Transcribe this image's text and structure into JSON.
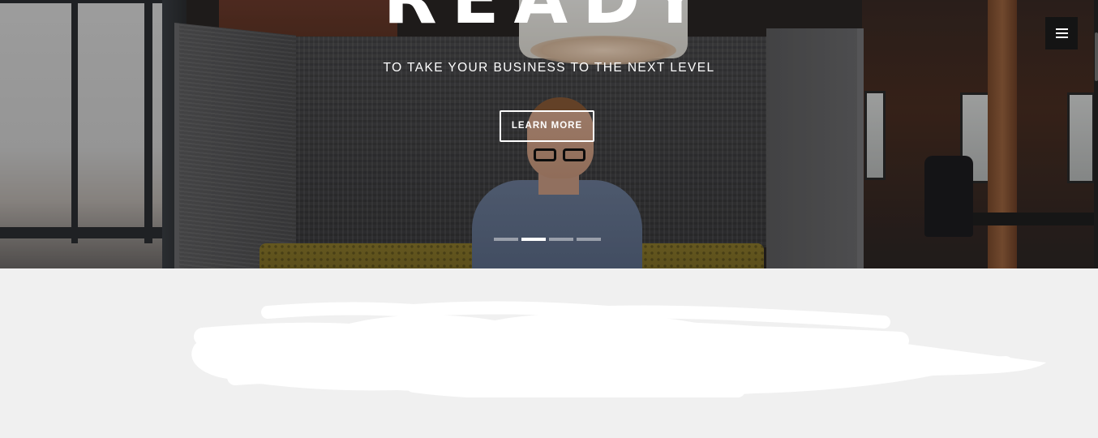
{
  "hero": {
    "title": "READY",
    "subtitle": "TO TAKE YOUR BUSINESS TO THE NEXT LEVEL",
    "cta_label": "LEARN MORE",
    "slides": [
      {
        "active": false
      },
      {
        "active": true
      },
      {
        "active": false
      },
      {
        "active": false
      }
    ]
  },
  "menu": {
    "icon": "hamburger-menu-icon"
  },
  "section": {
    "content": "redacted"
  },
  "colors": {
    "text_on_hero": "#ffffff",
    "menu_bg": "#141414",
    "section_bg": "#f0f0f0",
    "redaction": "#ffffff"
  }
}
